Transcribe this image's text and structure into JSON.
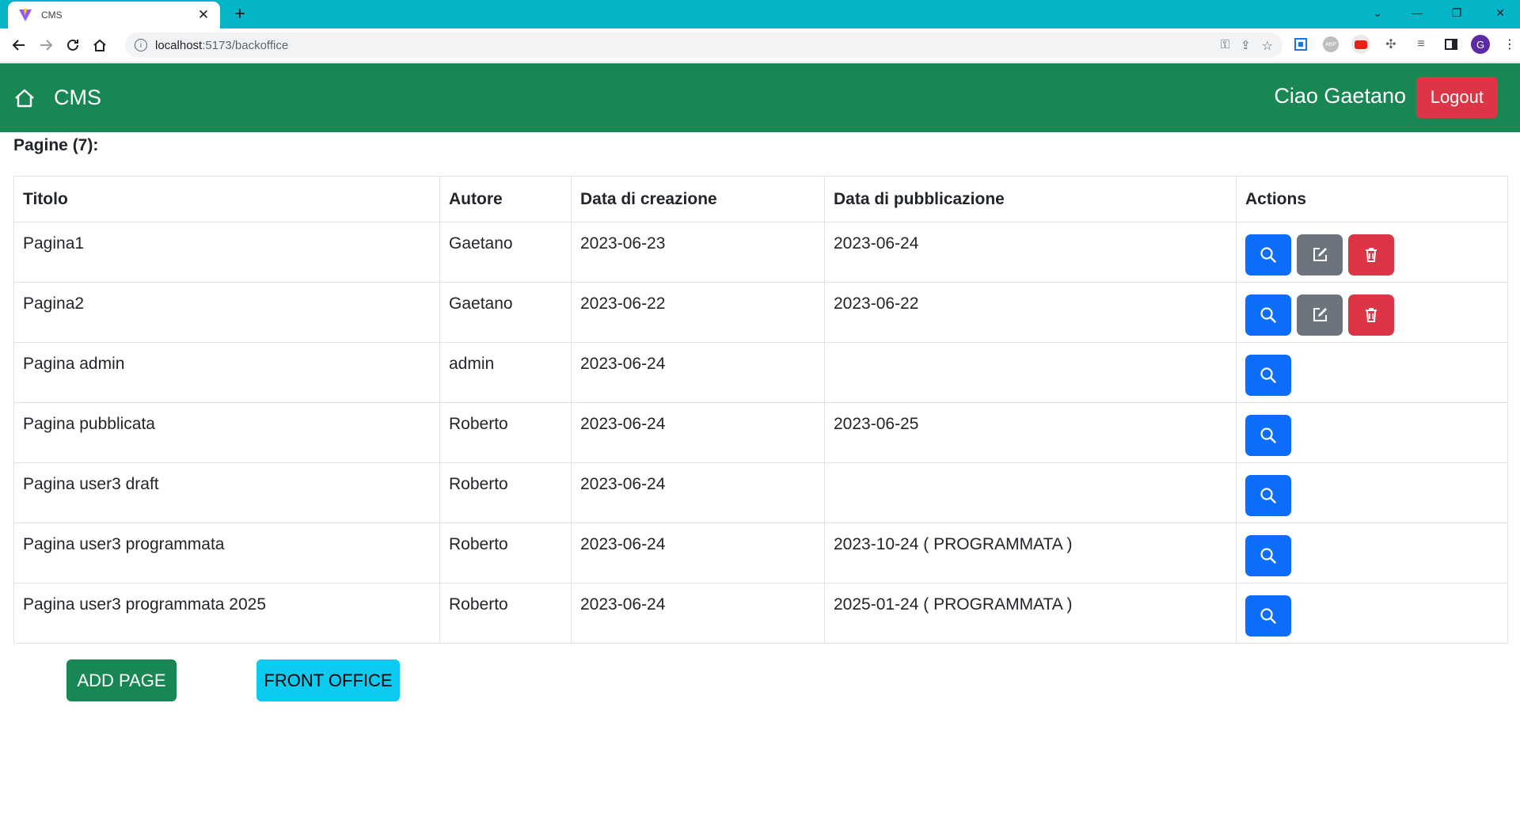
{
  "browser": {
    "tab_title": "CMS",
    "url_host": "localhost",
    "url_path": ":5173/backoffice",
    "profile_initial": "G"
  },
  "app": {
    "brand": "CMS",
    "greeting": "Ciao Gaetano",
    "logout_label": "Logout",
    "pages_heading": "Pagine (7):",
    "columns": [
      "Titolo",
      "Autore",
      "Data di creazione",
      "Data di pubblicazione",
      "Actions"
    ],
    "rows": [
      {
        "title": "Pagina1",
        "author": "Gaetano",
        "created": "2023-06-23",
        "published": "2023-06-24"
      },
      {
        "title": "Pagina2",
        "author": "Gaetano",
        "created": "2023-06-22",
        "published": "2023-06-22"
      },
      {
        "title": "Pagina admin",
        "author": "admin",
        "created": "2023-06-24",
        "published": ""
      },
      {
        "title": "Pagina pubblicata",
        "author": "Roberto",
        "created": "2023-06-24",
        "published": "2023-06-25"
      },
      {
        "title": "Pagina user3 draft",
        "author": "Roberto",
        "created": "2023-06-24",
        "published": ""
      },
      {
        "title": "Pagina user3 programmata",
        "author": "Roberto",
        "created": "2023-06-24",
        "published": "2023-10-24 ( PROGRAMMATA )"
      },
      {
        "title": "Pagina user3 programmata 2025",
        "author": "Roberto",
        "created": "2023-06-24",
        "published": "2025-01-24 ( PROGRAMMATA )"
      }
    ],
    "add_page_label": "ADD PAGE",
    "front_office_label": "FRONT OFFICE"
  },
  "colors": {
    "navbar": "#198754",
    "danger": "#dc3545",
    "primary": "#0d6efd",
    "secondary": "#6c757d",
    "info": "#0dcaf0",
    "chrome_tabstrip": "#04b5c8"
  },
  "icons": {
    "view": "search-icon",
    "edit": "edit-icon",
    "delete": "trash-icon",
    "home": "home-icon"
  }
}
